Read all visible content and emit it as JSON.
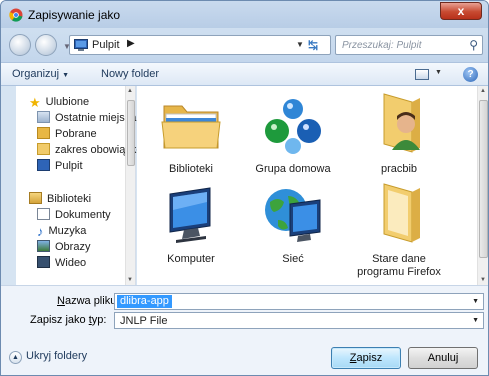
{
  "window": {
    "title": "Zapisywanie jako",
    "close_glyph": "x"
  },
  "address": {
    "location": "Pulpit",
    "separator": "▶",
    "search_placeholder": "Przeszukaj: Pulpit"
  },
  "toolbar": {
    "organize": "Organizuj",
    "new_folder": "Nowy folder",
    "help": "?"
  },
  "navpane": {
    "favorites_header": "Ulubione",
    "favorites": [
      "Ostatnie miejsca",
      "Pobrane",
      "zakres obowiązków",
      "Pulpit"
    ],
    "libraries_header": "Biblioteki",
    "libraries": [
      "Dokumenty",
      "Muzyka",
      "Obrazy",
      "Wideo"
    ]
  },
  "items": [
    {
      "label": "Biblioteki",
      "icon": "library-folder-icon"
    },
    {
      "label": "Grupa domowa",
      "icon": "homegroup-icon"
    },
    {
      "label": "pracbib",
      "icon": "user-folder-icon"
    },
    {
      "label": "Komputer",
      "icon": "computer-icon"
    },
    {
      "label": "Sieć",
      "icon": "network-icon"
    },
    {
      "label": "Stare dane programu Firefox",
      "icon": "folder-icon"
    }
  ],
  "fields": {
    "filename_label": "Nazwa pliku:",
    "filename_accel": "N",
    "filename_rest": "azwa pliku:",
    "filename_value": "dlibra-app",
    "type_label_pre": "Zapisz jako ",
    "type_label_accel": "t",
    "type_label_post": "yp:",
    "type_value": "JNLP File"
  },
  "footer": {
    "hide_folders": "Ukryj foldery",
    "save_accel": "Z",
    "save_rest": "apisz",
    "cancel": "Anuluj"
  },
  "colors": {
    "accent": "#3399ff",
    "title_bar": "#c9daee"
  }
}
